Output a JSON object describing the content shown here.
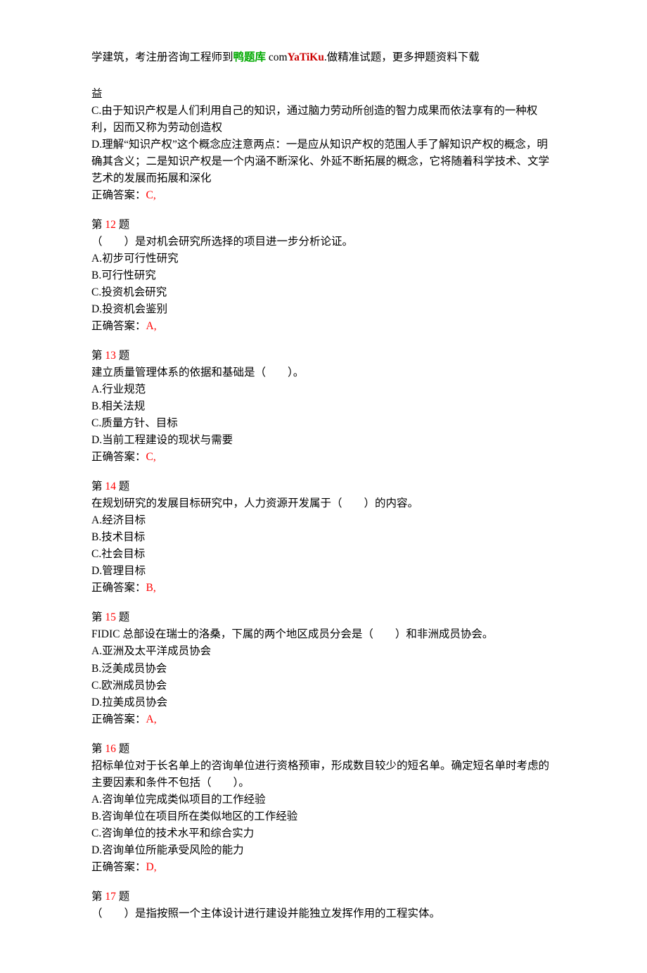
{
  "header": {
    "pre": "学建筑，考注册咨询工程师到",
    "green": "鸭题库",
    "rom1": " com",
    "red": "YaTiKu",
    "rom2": ".",
    "post": "做精准试题，更多押题资料下载"
  },
  "q11partial": {
    "lineA": "益",
    "optC": "C.由于知识产权是人们利用自己的知识，通过脑力劳动所创造的智力成果而依法享有的一种权利，因而又称为劳动创造权",
    "optD": "D.理解“知识产权”这个概念应注意两点：一是应从知识产权的范围人手了解知识产权的概念，明确其含义；二是知识产权是一个内涵不断深化、外延不断拓展的概念，它将随着科学技术、文学艺术的发展而拓展和深化",
    "ansLabel": "正确答案：",
    "ansVal": "C,"
  },
  "questions": [
    {
      "num": "12",
      "headPre": "第 ",
      "headPost": " 题",
      "stem": "（　　）是对机会研究所选择的项目进一步分析论证。",
      "opts": [
        "A.初步可行性研究",
        "B.可行性研究",
        "C.投资机会研究",
        "D.投资机会鉴别"
      ],
      "ansLabel": "正确答案：",
      "ansVal": "A,"
    },
    {
      "num": "13",
      "headPre": "第 ",
      "headPost": " 题",
      "stem": "建立质量管理体系的依据和基础是（　　）。",
      "opts": [
        "A.行业规范",
        "B.相关法规",
        "C.质量方针、目标",
        "D.当前工程建设的现状与需要"
      ],
      "ansLabel": "正确答案：",
      "ansVal": "C,"
    },
    {
      "num": "14",
      "headPre": "第 ",
      "headPost": " 题",
      "stem": "在规划研究的发展目标研究中，人力资源开发属于（　　）的内容。",
      "opts": [
        "A.经济目标",
        "B.技术目标",
        "C.社会目标",
        "D.管理目标"
      ],
      "ansLabel": "正确答案：",
      "ansVal": "B,"
    },
    {
      "num": "15",
      "headPre": "第 ",
      "headPost": " 题",
      "stemPre": "FIDIC",
      "stemPost": " 总部设在瑞士的洛桑，下属的两个地区成员分会是（　　）和非洲成员协会。",
      "opts": [
        "A.亚洲及太平洋成员协会",
        "B.泛美成员协会",
        "C.欧洲成员协会",
        "D.拉美成员协会"
      ],
      "ansLabel": "正确答案：",
      "ansVal": "A,"
    },
    {
      "num": "16",
      "headPre": "第 ",
      "headPost": " 题",
      "stem": "招标单位对于长名单上的咨询单位进行资格预审，形成数目较少的短名单。确定短名单时考虑的主要因素和条件不包括（　　）。",
      "opts": [
        "A.咨询单位完成类似项目的工作经验",
        "B.咨询单位在项目所在类似地区的工作经验",
        "C.咨询单位的技术水平和综合实力",
        "D.咨询单位所能承受风险的能力"
      ],
      "ansLabel": "正确答案：",
      "ansVal": "D,"
    },
    {
      "num": "17",
      "headPre": "第 ",
      "headPost": " 题",
      "stem": "（　　）是指按照一个主体设计进行建设并能独立发挥作用的工程实体。",
      "opts": [],
      "ansLabel": "",
      "ansVal": ""
    }
  ]
}
